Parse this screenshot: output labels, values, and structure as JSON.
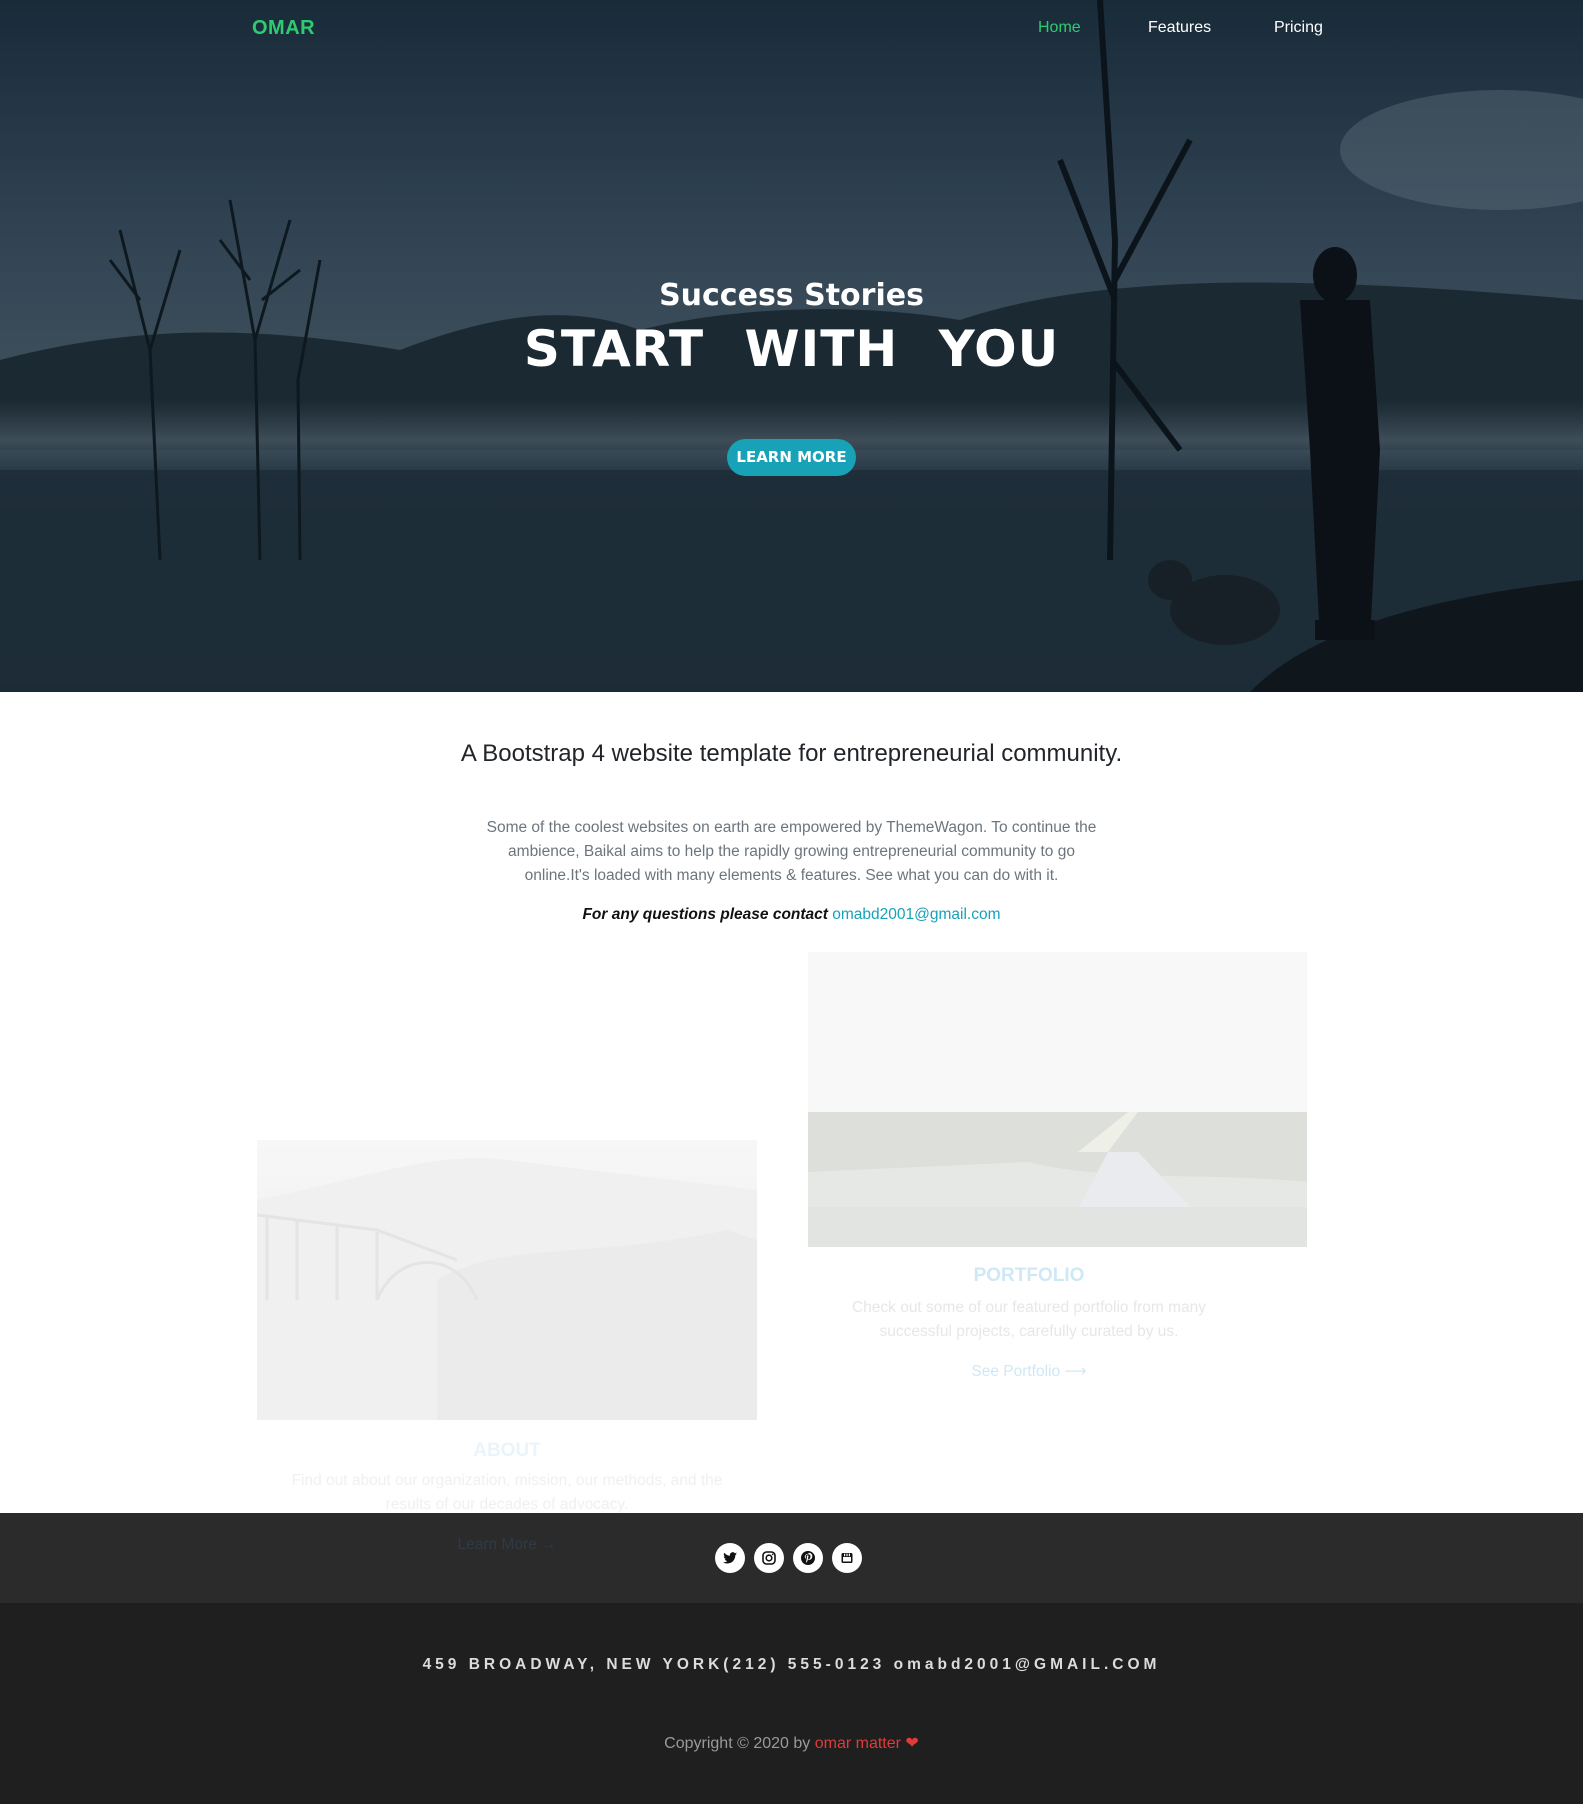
{
  "nav": {
    "brand": "OMAR",
    "links": [
      "Home",
      "Features",
      "Pricing"
    ],
    "active": "Home"
  },
  "hero": {
    "subtitle": "Success Stories",
    "title": "START WITH YOU",
    "button": "LEARN MORE"
  },
  "intro": {
    "heading": "A Bootstrap 4 website template for entrepreneurial community.",
    "text": "Some of the coolest websites on earth are empowered by ThemeWagon. To continue the ambience, Baikal aims to help the rapidly growing entrepreneurial community to go online.It's loaded with many elements & features. See what you can do with it.",
    "contact_label": "For any questions please contact",
    "contact_email": "omabd2001@gmail.com"
  },
  "cards": {
    "about": {
      "title": "ABOUT",
      "text": "Find out about our organization, mission, our methods, and the results of our decades of advocacy.",
      "link": "Learn More →"
    },
    "portfolio": {
      "title": "PORTFOLIO",
      "text": "Check out some of our featured portfolio from many successful projects, carefully curated by us.",
      "link": "See Portfolio ⟶"
    }
  },
  "social": {
    "icons": [
      "twitter-icon",
      "instagram-icon",
      "pinterest-icon",
      "youtube-icon"
    ]
  },
  "footer": {
    "address": "459 BROADWAY, NEW YORK(212) 555-0123 omabd2001@GMAIL.COM",
    "copyright_prefix": "Copyright © 2020 by",
    "author": "omar matter",
    "heart": "❤"
  },
  "colors": {
    "accent_green": "#2ecc71",
    "accent_teal": "#17a2b8",
    "footer_bg": "#1f1f1f",
    "social_bg": "#2b2b2b",
    "heart_red": "#e03a3a"
  }
}
